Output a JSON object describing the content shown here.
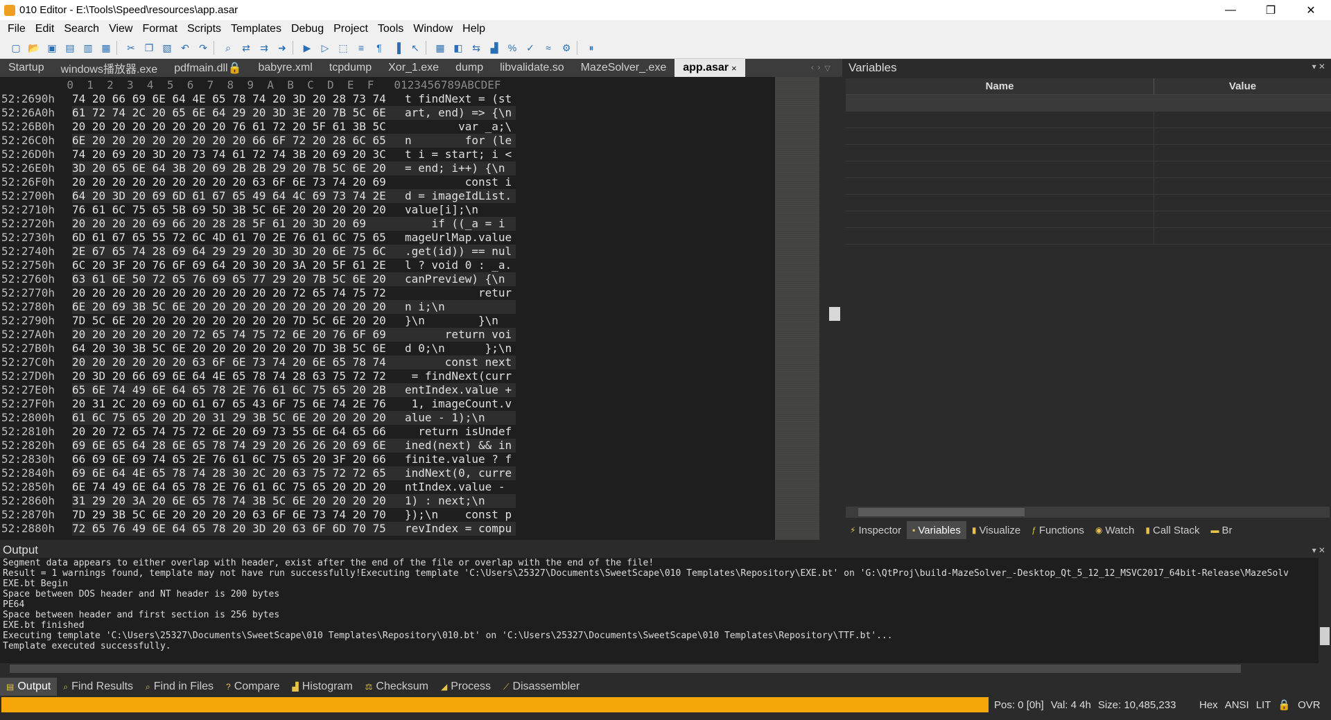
{
  "window": {
    "title": "010 Editor - E:\\Tools\\Speed\\resources\\app.asar",
    "minimize": "—",
    "restore": "❐",
    "close": "✕"
  },
  "menu": [
    "File",
    "Edit",
    "Search",
    "View",
    "Format",
    "Scripts",
    "Templates",
    "Debug",
    "Project",
    "Tools",
    "Window",
    "Help"
  ],
  "toolbar_icons": [
    "new-file-icon",
    "open-file-icon",
    "save-icon",
    "save-all-icon",
    "close-file-icon",
    "open-folder-icon",
    "cut-icon",
    "copy-icon",
    "paste-icon",
    "undo-icon",
    "redo-icon",
    "find-icon",
    "find-replace-icon",
    "find-in-files-icon",
    "goto-icon",
    "template-icon",
    "script-icon",
    "hex-mode-icon",
    "text-mode-icon",
    "whitespace-icon",
    "columns-icon",
    "pointer-icon",
    "calculator-icon",
    "inspector-icon",
    "compare-icon",
    "histogram-icon",
    "checksum-icon",
    "disassemble-icon",
    "mov-icon",
    "debug-icon",
    "pause-icon"
  ],
  "file_tabs": [
    {
      "label": "Startup"
    },
    {
      "label": "windows播放器.exe"
    },
    {
      "label": "pdfmain.dll🔒"
    },
    {
      "label": "babyre.xml"
    },
    {
      "label": "tcpdump"
    },
    {
      "label": "Xor_1.exe"
    },
    {
      "label": "dump"
    },
    {
      "label": "libvalidate.so"
    },
    {
      "label": "MazeSolver_.exe"
    },
    {
      "label": "app.asar",
      "active": true
    }
  ],
  "hex": {
    "header": "          0  1  2  3  4  5  6  7  8  9  A  B  C  D  E  F   0123456789ABCDEF",
    "rows": [
      {
        "addr": "52:2690h",
        "bytes": "74 20 66 69 6E 64 4E 65 78 74 20 3D 20 28 73 74",
        "ascii": "t findNext = (st"
      },
      {
        "addr": "52:26A0h",
        "bytes": "61 72 74 2C 20 65 6E 64 29 20 3D 3E 20 7B 5C 6E",
        "ascii": "art, end) => {\\n"
      },
      {
        "addr": "52:26B0h",
        "bytes": "20 20 20 20 20 20 20 20 76 61 72 20 5F 61 3B 5C",
        "ascii": "        var _a;\\"
      },
      {
        "addr": "52:26C0h",
        "bytes": "6E 20 20 20 20 20 20 20 20 66 6F 72 20 28 6C 65",
        "ascii": "n        for (le"
      },
      {
        "addr": "52:26D0h",
        "bytes": "74 20 69 20 3D 20 73 74 61 72 74 3B 20 69 20 3C",
        "ascii": "t i = start; i <"
      },
      {
        "addr": "52:26E0h",
        "bytes": "3D 20 65 6E 64 3B 20 69 2B 2B 29 20 7B 5C 6E 20",
        "ascii": "= end; i++) {\\n "
      },
      {
        "addr": "52:26F0h",
        "bytes": "20 20 20 20 20 20 20 20 20 63 6F 6E 73 74 20 69",
        "ascii": "         const i"
      },
      {
        "addr": "52:2700h",
        "bytes": "64 20 3D 20 69 6D 61 67 65 49 64 4C 69 73 74 2E",
        "ascii": "d = imageIdList."
      },
      {
        "addr": "52:2710h",
        "bytes": "76 61 6C 75 65 5B 69 5D 3B 5C 6E 20 20 20 20 20",
        "ascii": "value[i];\\n     "
      },
      {
        "addr": "52:2720h",
        "bytes": "20 20 20 20 69 66 20 28 28 5F 61 20 3D 20 69",
        "ascii": "    if ((_a = i"
      },
      {
        "addr": "52:2730h",
        "bytes": "6D 61 67 65 55 72 6C 4D 61 70 2E 76 61 6C 75 65",
        "ascii": "mageUrlMap.value"
      },
      {
        "addr": "52:2740h",
        "bytes": "2E 67 65 74 28 69 64 29 29 20 3D 3D 20 6E 75 6C",
        "ascii": ".get(id)) == nul"
      },
      {
        "addr": "52:2750h",
        "bytes": "6C 20 3F 20 76 6F 69 64 20 30 20 3A 20 5F 61 2E",
        "ascii": "l ? void 0 : _a."
      },
      {
        "addr": "52:2760h",
        "bytes": "63 61 6E 50 72 65 76 69 65 77 29 20 7B 5C 6E 20",
        "ascii": "canPreview) {\\n "
      },
      {
        "addr": "52:2770h",
        "bytes": "20 20 20 20 20 20 20 20 20 20 20 72 65 74 75 72",
        "ascii": "           retur"
      },
      {
        "addr": "52:2780h",
        "bytes": "6E 20 69 3B 5C 6E 20 20 20 20 20 20 20 20 20 20",
        "ascii": "n i;\\n          "
      },
      {
        "addr": "52:2790h",
        "bytes": "7D 5C 6E 20 20 20 20 20 20 20 20 7D 5C 6E 20 20",
        "ascii": "}\\n        }\\n  "
      },
      {
        "addr": "52:27A0h",
        "bytes": "20 20 20 20 20 20 72 65 74 75 72 6E 20 76 6F 69",
        "ascii": "      return voi"
      },
      {
        "addr": "52:27B0h",
        "bytes": "64 20 30 3B 5C 6E 20 20 20 20 20 20 7D 3B 5C 6E",
        "ascii": "d 0;\\n      };\\n"
      },
      {
        "addr": "52:27C0h",
        "bytes": "20 20 20 20 20 20 63 6F 6E 73 74 20 6E 65 78 74",
        "ascii": "      const next"
      },
      {
        "addr": "52:27D0h",
        "bytes": "20 3D 20 66 69 6E 64 4E 65 78 74 28 63 75 72 72",
        "ascii": " = findNext(curr"
      },
      {
        "addr": "52:27E0h",
        "bytes": "65 6E 74 49 6E 64 65 78 2E 76 61 6C 75 65 20 2B",
        "ascii": "entIndex.value +"
      },
      {
        "addr": "52:27F0h",
        "bytes": "20 31 2C 20 69 6D 61 67 65 43 6F 75 6E 74 2E 76",
        "ascii": " 1, imageCount.v"
      },
      {
        "addr": "52:2800h",
        "bytes": "61 6C 75 65 20 2D 20 31 29 3B 5C 6E 20 20 20 20",
        "ascii": "alue - 1);\\n    "
      },
      {
        "addr": "52:2810h",
        "bytes": "20 20 72 65 74 75 72 6E 20 69 73 55 6E 64 65 66",
        "ascii": "  return isUndef"
      },
      {
        "addr": "52:2820h",
        "bytes": "69 6E 65 64 28 6E 65 78 74 29 20 26 26 20 69 6E",
        "ascii": "ined(next) && in"
      },
      {
        "addr": "52:2830h",
        "bytes": "66 69 6E 69 74 65 2E 76 61 6C 75 65 20 3F 20 66",
        "ascii": "finite.value ? f"
      },
      {
        "addr": "52:2840h",
        "bytes": "69 6E 64 4E 65 78 74 28 30 2C 20 63 75 72 72 65",
        "ascii": "indNext(0, curre"
      },
      {
        "addr": "52:2850h",
        "bytes": "6E 74 49 6E 64 65 78 2E 76 61 6C 75 65 20 2D 20",
        "ascii": "ntIndex.value - "
      },
      {
        "addr": "52:2860h",
        "bytes": "31 29 20 3A 20 6E 65 78 74 3B 5C 6E 20 20 20 20",
        "ascii": "1) : next;\\n    "
      },
      {
        "addr": "52:2870h",
        "bytes": "7D 29 3B 5C 6E 20 20 20 20 63 6F 6E 73 74 20 70",
        "ascii": "});\\n    const p"
      },
      {
        "addr": "52:2880h",
        "bytes": "72 65 76 49 6E 64 65 78 20 3D 20 63 6F 6D 70 75",
        "ascii": "revIndex = compu"
      }
    ]
  },
  "variables_panel": {
    "title": "Variables",
    "col_name": "Name",
    "col_value": "Value",
    "tabs": [
      "Inspector",
      "Variables",
      "Visualize",
      "Functions",
      "Watch",
      "Call Stack",
      "Br"
    ]
  },
  "output": {
    "title": "Output",
    "lines": [
      "Segment data appears to either overlap with header, exist after the end of the file or overlap with the end of the file!",
      "Result = 1 warnings found, template may not have run successfully!Executing template 'C:\\Users\\25327\\Documents\\SweetScape\\010 Templates\\Repository\\EXE.bt' on 'G:\\QtProj\\build-MazeSolver_-Desktop_Qt_5_12_12_MSVC2017_64bit-Release\\MazeSolv",
      "EXE.bt Begin",
      "Space between DOS header and NT header is 200 bytes",
      "PE64",
      "Space between header and first section is 256 bytes",
      "EXE.bt finished",
      "Executing template 'C:\\Users\\25327\\Documents\\SweetScape\\010 Templates\\Repository\\010.bt' on 'C:\\Users\\25327\\Documents\\SweetScape\\010 Templates\\Repository\\TTF.bt'...",
      "Template executed successfully."
    ]
  },
  "bottom_tabs": [
    "Output",
    "Find Results",
    "Find in Files",
    "Compare",
    "Histogram",
    "Checksum",
    "Process",
    "Disassembler"
  ],
  "status": {
    "pos": "Pos: 0 [0h]",
    "val": "Val: 4 4h",
    "size": "Size: 10,485,233",
    "hex": "Hex",
    "ansi": "ANSI",
    "lit": "LIT",
    "ovr": "OVR",
    "bar_color": "#f5a70a"
  }
}
